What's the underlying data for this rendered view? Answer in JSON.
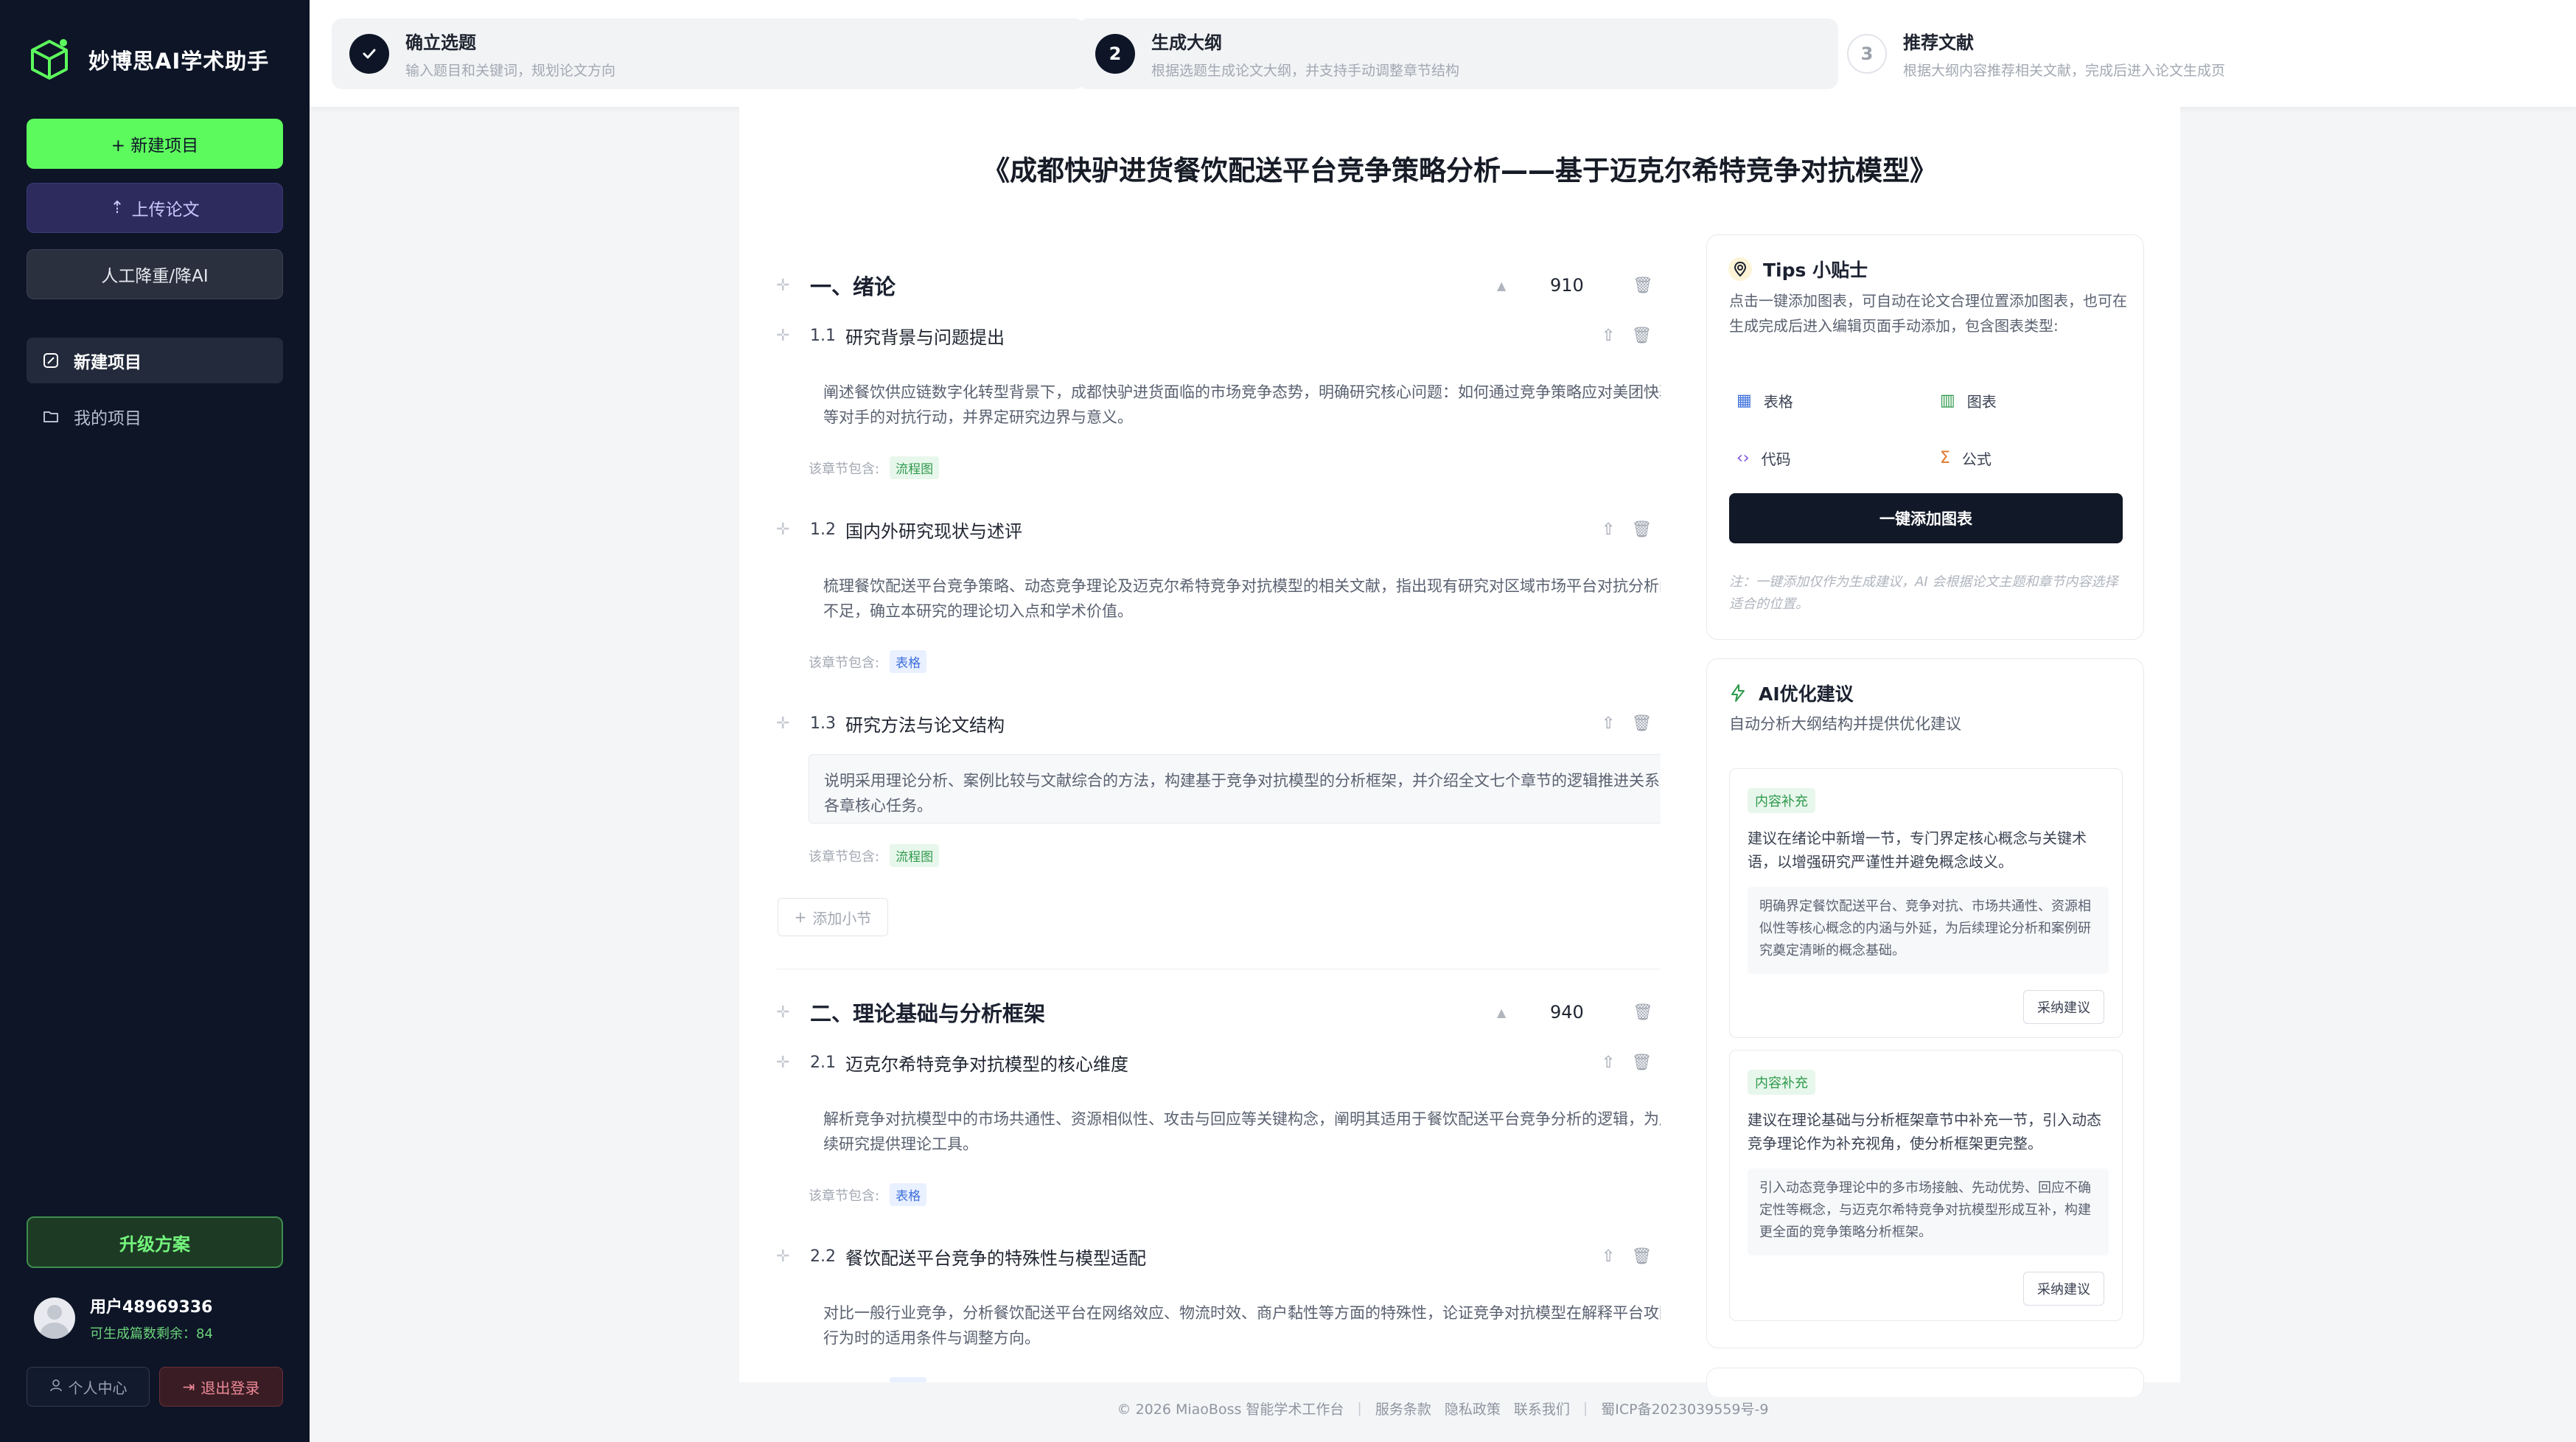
{
  "sidebar": {
    "brand": "妙博思AI学术助手",
    "btn_new": "+ 新建项目",
    "btn_upload": "上传论文",
    "btn_rewrite": "人工降重/降AI",
    "nav": {
      "new_project": "新建项目",
      "my_projects": "我的项目"
    },
    "upgrade": "升级方案",
    "user": {
      "name": "用户48969336",
      "quota": "可生成篇数剩余：84"
    },
    "profile": "个人中心",
    "logout": "退出登录"
  },
  "steps": [
    {
      "num": "",
      "title": "确立选题",
      "desc": "输入题目和关键词，规划论文方向",
      "state": "done"
    },
    {
      "num": "2",
      "title": "生成大纲",
      "desc": "根据选题生成论文大纲，并支持手动调整章节结构",
      "state": "active"
    },
    {
      "num": "3",
      "title": "推荐文献",
      "desc": "根据大纲内容推荐相关文献，完成后进入论文生成页",
      "state": "todo"
    }
  ],
  "doc_title": "《成都快驴进货餐饮配送平台竞争策略分析——基于迈克尔希特竞争对抗模型》",
  "tag_prefix": "该章节包含:",
  "add_subsection": "添加小节",
  "chapters": [
    {
      "title": "一、绪论",
      "words": "910",
      "sections": [
        {
          "num": "1.1",
          "title": "研究背景与问题提出",
          "body": "阐述餐饮供应链数字化转型背景下，成都快驴进货面临的市场竞争态势，明确研究核心问题：如何通过竞争策略应对美团快驴等对手的对抗行动，并界定研究边界与意义。",
          "tag": "流程图"
        },
        {
          "num": "1.2",
          "title": "国内外研究现状与述评",
          "body": "梳理餐饮配送平台竞争策略、动态竞争理论及迈克尔希特竞争对抗模型的相关文献，指出现有研究对区域市场平台对抗分析的不足，确立本研究的理论切入点和学术价值。",
          "tag": "表格"
        },
        {
          "num": "1.3",
          "title": "研究方法与论文结构",
          "body": "说明采用理论分析、案例比较与文献综合的方法，构建基于竞争对抗模型的分析框架，并介绍全文七个章节的逻辑推进关系及各章核心任务。",
          "tag": "流程图"
        }
      ]
    },
    {
      "title": "二、理论基础与分析框架",
      "words": "940",
      "sections": [
        {
          "num": "2.1",
          "title": "迈克尔希特竞争对抗模型的核心维度",
          "body": "解析竞争对抗模型中的市场共通性、资源相似性、攻击与回应等关键构念，阐明其适用于餐饮配送平台竞争分析的逻辑，为后续研究提供理论工具。",
          "tag": "表格"
        },
        {
          "num": "2.2",
          "title": "餐饮配送平台竞争的特殊性与模型适配",
          "body": "对比一般行业竞争，分析餐饮配送平台在网络效应、物流时效、商户黏性等方面的特殊性，论证竞争对抗模型在解释平台攻防行为时的适用条件与调整方向。",
          "tag": "表格"
        }
      ]
    }
  ],
  "tips": {
    "title": "Tips 小贴士",
    "desc": "点击一键添加图表，可自动在论文合理位置添加图表，也可在生成完成后进入编辑页面手动添加，包含图表类型:",
    "tools": {
      "table": "表格",
      "chart": "图表",
      "code": "代码",
      "formula": "公式"
    },
    "button": "一键添加图表",
    "note": "注：一键添加仅作为生成建议，AI 会根据论文主题和章节内容选择适合的位置。"
  },
  "ai": {
    "title": "AI优化建议",
    "desc": "自动分析大纲结构并提供优化建议",
    "suggestions": [
      {
        "tag": "内容补充",
        "text": "建议在绪论中新增一节，专门界定核心概念与关键术语，以增强研究严谨性并避免概念歧义。",
        "detail": "明确界定餐饮配送平台、竞争对抗、市场共通性、资源相似性等核心概念的内涵与外延，为后续理论分析和案例研究奠定清晰的概念基础。",
        "button": "采纳建议"
      },
      {
        "tag": "内容补充",
        "text": "建议在理论基础与分析框架章节中补充一节，引入动态竞争理论作为补充视角，使分析框架更完整。",
        "detail": "引入动态竞争理论中的多市场接触、先动优势、回应不确定性等概念，与迈克尔希特竞争对抗模型形成互补，构建更全面的竞争策略分析框架。",
        "button": "采纳建议"
      }
    ]
  },
  "footer": {
    "copyright": "© 2026 MiaoBoss 智能学术工作台",
    "terms": "服务条款",
    "privacy": "隐私政策",
    "contact": "联系我们",
    "icp": "蜀ICP备2023039559号-9"
  }
}
